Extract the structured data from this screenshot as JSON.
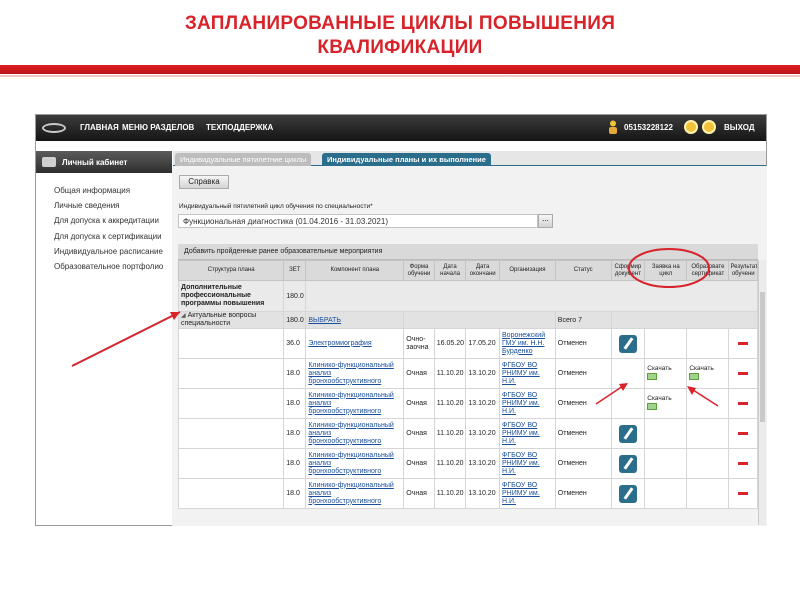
{
  "slide": {
    "title_line1": "ЗАПЛАНИРОВАННЫЕ ЦИКЛЫ ПОВЫШЕНИЯ",
    "title_line2": "КВАЛИФИКАЦИИ"
  },
  "topbar": {
    "nav": [
      "ГЛАВНАЯ",
      "МЕНЮ РАЗДЕЛОВ",
      "ТЕХПОДДЕРЖКА"
    ],
    "phone": "05153228122",
    "exit": "ВЫХОД"
  },
  "sidebar": {
    "title": "Личный кабинет",
    "items": [
      "Общая информация",
      "Личные сведения",
      "Для допуска к аккредитации",
      "Для допуска к сертификации",
      "Индивидуальное расписание",
      "Образовательное портфолио"
    ]
  },
  "tabs": [
    "Индивидуальные пятилетние циклы",
    "Индивидуальные планы и их выполнение"
  ],
  "help_button": "Справка",
  "cycle": {
    "label": "Индивидуальный пятилетний цикл обучения по специальности*",
    "value": "Функциональная диагностика (01.04.2016 - 31.03.2021)",
    "button": "..."
  },
  "add_bar": "Добавить пройденные ранее образовательные мероприятия",
  "table": {
    "headers": [
      "Структура плана",
      "ЗЕТ",
      "Компонент плана",
      "Форма обучени",
      "Дата начала",
      "Дата окончани",
      "Организация",
      "Статус",
      "Сформир документ",
      "Заявка на цикл",
      "Образовате сертификат",
      "Результат обучени"
    ],
    "group": {
      "title": "Дополнительные профессиональные программы повышения",
      "zet": "180.0"
    },
    "subgroup": {
      "title": "Актуальные вопросы специальности",
      "zet": "180.0",
      "action": "ВЫБРАТЬ",
      "total": "Всего 7"
    },
    "rows": [
      {
        "zet": "36.0",
        "component": "Электромиография",
        "form": "Очно-заочна",
        "start": "16.05.20",
        "end": "17.05.20",
        "org": "Воронежский ГМУ им. Н.Н. Бурденко",
        "status": "Отменен",
        "doc": "pen",
        "request": "",
        "certificate": "",
        "result": "minus"
      },
      {
        "zet": "18.0",
        "component": "Клинико-функциональный анализ бронхообструктивного",
        "form": "Очная",
        "start": "11.10.20",
        "end": "13.10.20",
        "org": "ФГБОУ ВО РНИМУ им. Н.И.",
        "status": "Отменен",
        "doc": "",
        "request": "Скачать",
        "certificate": "Скачать",
        "result": "minus"
      },
      {
        "zet": "18.0",
        "component": "Клинико-функциональный анализ бронхообструктивного",
        "form": "Очная",
        "start": "11.10.20",
        "end": "13.10.20",
        "org": "ФГБОУ ВО РНИМУ им. Н.И.",
        "status": "Отменен",
        "doc": "",
        "request": "Скачать",
        "certificate": "",
        "result": "minus"
      },
      {
        "zet": "18.0",
        "component": "Клинико-функциональный анализ бронхообструктивного",
        "form": "Очная",
        "start": "11.10.20",
        "end": "13.10.20",
        "org": "ФГБОУ ВО РНИМУ им. Н.И.",
        "status": "Отменен",
        "doc": "pen",
        "request": "",
        "certificate": "",
        "result": "minus"
      },
      {
        "zet": "18.0",
        "component": "Клинико-функциональный анализ бронхообструктивного",
        "form": "Очная",
        "start": "11.10.20",
        "end": "13.10.20",
        "org": "ФГБОУ ВО РНИМУ им. Н.И.",
        "status": "Отменен",
        "doc": "pen",
        "request": "",
        "certificate": "",
        "result": "minus"
      },
      {
        "zet": "18.0",
        "component": "Клинико-функциональный анализ бронхообструктивного",
        "form": "Очная",
        "start": "11.10.20",
        "end": "13.10.20",
        "org": "ФГБОУ ВО РНИМУ им. Н.И.",
        "status": "Отменен",
        "doc": "pen",
        "request": "",
        "certificate": "",
        "result": "minus"
      }
    ]
  },
  "colors": {
    "accent": "#d8232a",
    "tab_active": "#2a6e8c",
    "link": "#1a4f9c"
  }
}
